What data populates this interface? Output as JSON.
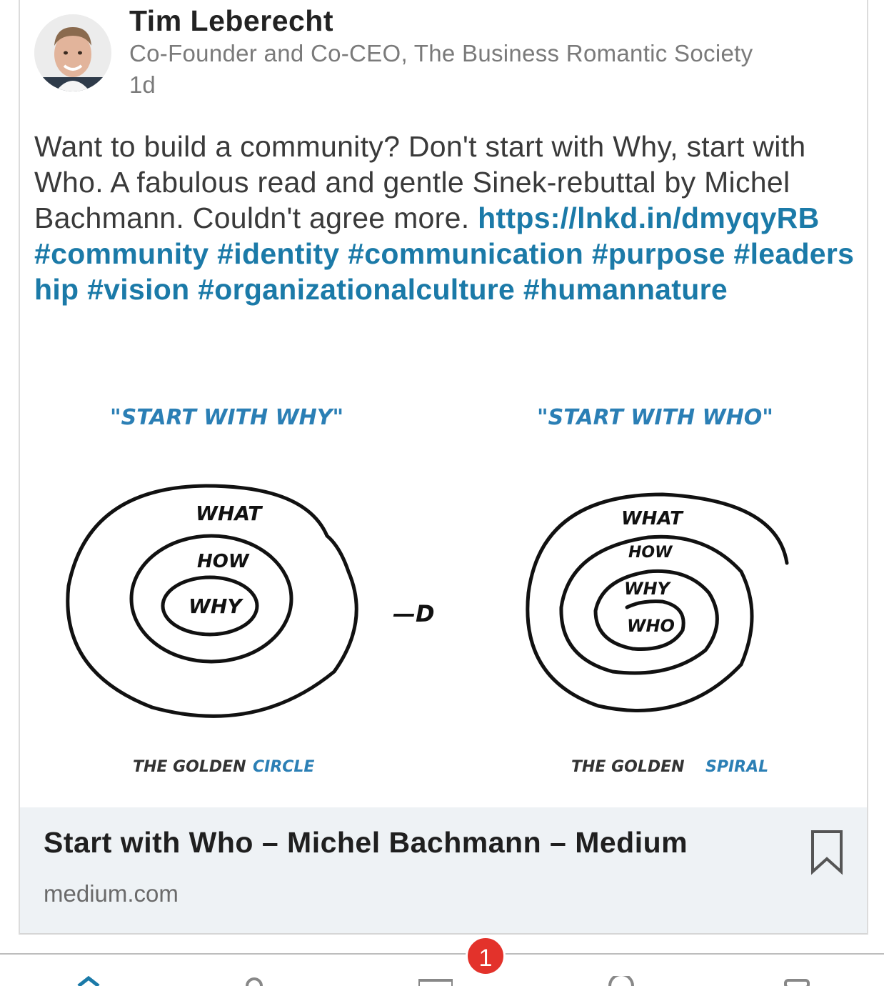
{
  "post": {
    "author": {
      "name": "Tim Leberecht",
      "headline": "Co-Founder and Co-CEO, The Business Romantic Society",
      "time": "1d"
    },
    "text": "Want to build a community? Don't start with Why, start with Who. A fabulous read and gentle Sinek-rebuttal by Michel Bachmann. Couldn't agree more.",
    "link": "https://lnkd.in/dmyqyRB",
    "hashtags": "#community #identity #communication #purpose #leadership #vision #organizationalculture #humannature"
  },
  "image": {
    "left_title": "\"START WITH WHY\"",
    "right_title": "\"START WITH WHO\"",
    "left_rings": {
      "outer": "WHAT",
      "middle": "HOW",
      "inner": "WHY"
    },
    "right_rings": {
      "outer": "WHAT",
      "middle": "HOW",
      "inner": "WHY",
      "core": "WHO"
    },
    "arrow": "—D",
    "left_caption": {
      "prefix": "THE GOLDEN",
      "highlight": "CIRCLE"
    },
    "right_caption": {
      "prefix": "THE GOLDEN",
      "highlight": "SPIRAL"
    }
  },
  "link_preview": {
    "title": "Start with Who – Michel Bachmann – Medium",
    "domain": "medium.com",
    "bookmark_icon": "bookmark-icon"
  },
  "bottom_nav": {
    "messaging_badge": "1"
  },
  "colors": {
    "link": "#1b7aa8",
    "sketch_blue": "#2b7fb5",
    "badge": "#e3322b",
    "preview_bg": "#eef2f5"
  }
}
